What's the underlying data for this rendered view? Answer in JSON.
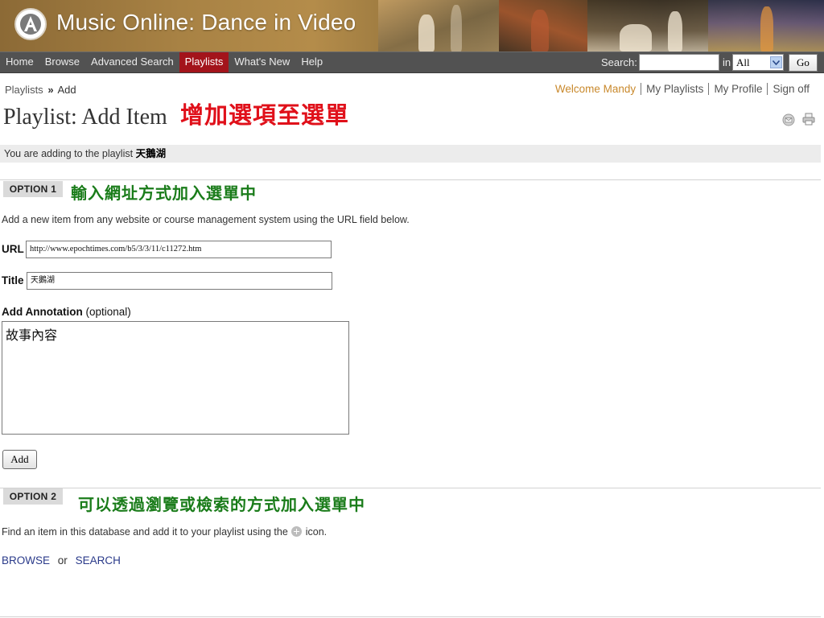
{
  "site": {
    "title": "Music Online: Dance in Video"
  },
  "nav": {
    "items": [
      {
        "label": "Home"
      },
      {
        "label": "Browse"
      },
      {
        "label": "Advanced Search"
      },
      {
        "label": "Playlists",
        "active": true
      },
      {
        "label": "What's New"
      },
      {
        "label": "Help"
      }
    ],
    "search_label": "Search:",
    "search_value": "",
    "in_label": "in",
    "scope_value": "All",
    "go_label": "Go"
  },
  "breadcrumb": {
    "parent": "Playlists",
    "separator": "»",
    "current": "Add"
  },
  "user_links": {
    "welcome": "Welcome Mandy",
    "playlists": "My Playlists",
    "profile": "My Profile",
    "signoff": "Sign off"
  },
  "page": {
    "title": "Playlist: Add Item",
    "annotation_title": "增加選項至選單"
  },
  "notice": {
    "prefix": "You are adding to the playlist",
    "playlist_name": "天鵝湖"
  },
  "option1": {
    "badge": "OPTION 1",
    "annotation": "輸入網址方式加入選單中",
    "description": "Add a new item from any website or course management system using the URL field below.",
    "url_label": "URL",
    "url_value": "http://www.epochtimes.com/b5/3/3/11/c11272.htm",
    "title_label": "Title",
    "title_value": "天鵝湖",
    "annotation_label": "Add Annotation",
    "annotation_optional": "(optional)",
    "annotation_value": "故事內容",
    "add_label": "Add"
  },
  "option2": {
    "badge": "OPTION 2",
    "annotation": "可以透過瀏覽或檢索的方式加入選單中",
    "description_before": "Find an item in this database and add it to your playlist using the",
    "description_after": "icon.",
    "browse_label": "BROWSE",
    "or_label": "or",
    "search_label": "SEARCH"
  },
  "colors": {
    "nav_active": "#a3141b",
    "nav_bg": "#525252",
    "welcome": "#c9892c",
    "annotation_red": "#e0101a",
    "annotation_green": "#1a7c1a",
    "link_blue": "#2a3a8a"
  },
  "icons": {
    "logo": "logo-a-icon",
    "email": "email-icon",
    "print": "printer-icon",
    "add": "plus-circle-icon",
    "dropdown": "chevron-down-icon"
  }
}
